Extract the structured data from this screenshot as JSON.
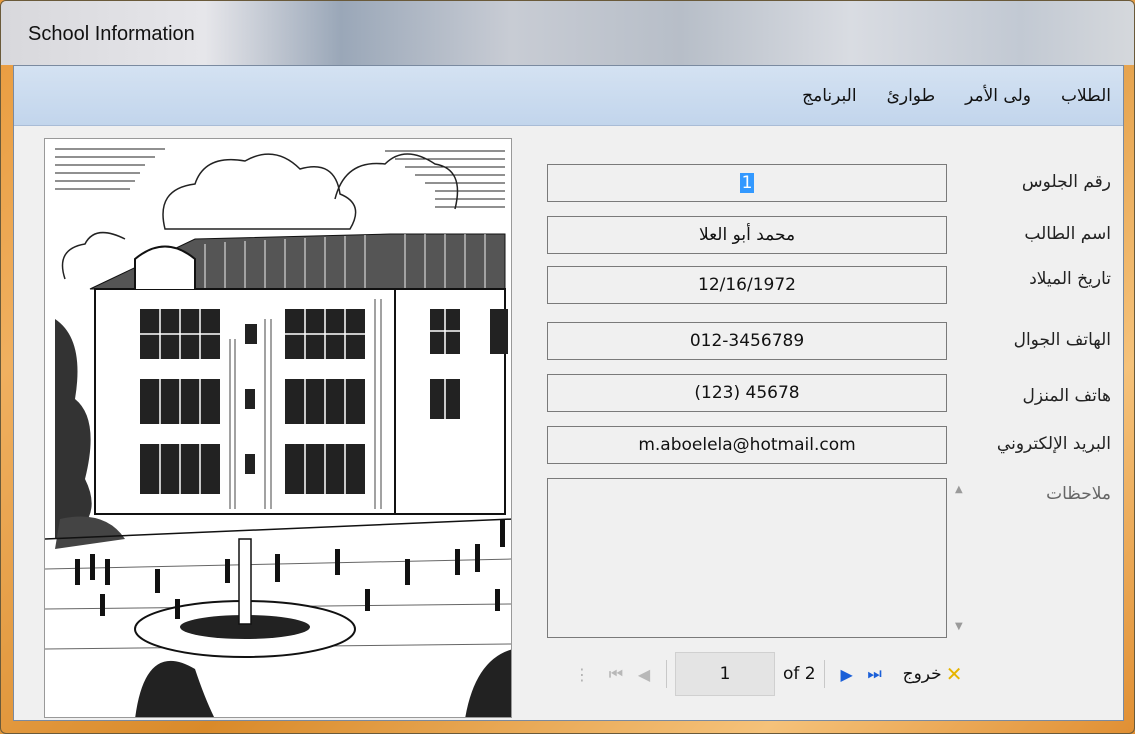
{
  "window": {
    "title": "School Information"
  },
  "menu": {
    "items": [
      {
        "label": "الطلاب"
      },
      {
        "label": "ولى الأمر"
      },
      {
        "label": "طوارئ"
      },
      {
        "label": "البرنامج"
      }
    ]
  },
  "form": {
    "fields": [
      {
        "label": "رقم الجلوس",
        "value": "1",
        "selected": true
      },
      {
        "label": "اسم الطالب",
        "value": "محمد أبو العلا"
      },
      {
        "label": "تاريخ الميلاد",
        "value": "12/16/1972"
      },
      {
        "label": "الهاتف الجوال",
        "value": "012-3456789"
      },
      {
        "label": "هاتف المنزل",
        "value": "(123) 45678"
      },
      {
        "label": "البريد الإلكتروني",
        "value": "m.aboelela@hotmail.com"
      }
    ],
    "notes_label": "ملاحظات",
    "notes_value": ""
  },
  "navigator": {
    "position": "1",
    "of_text": "of 2",
    "exit_label": "خروج"
  },
  "icons": {
    "first": "first-record-icon",
    "prev": "previous-record-icon",
    "next": "next-record-icon",
    "last": "last-record-icon",
    "exit": "exit-icon"
  },
  "colors": {
    "menubar": "#c2d5ec",
    "selection": "#3399ff",
    "nav_enabled": "#1a5fd8",
    "exit_icon": "#e6b400"
  }
}
